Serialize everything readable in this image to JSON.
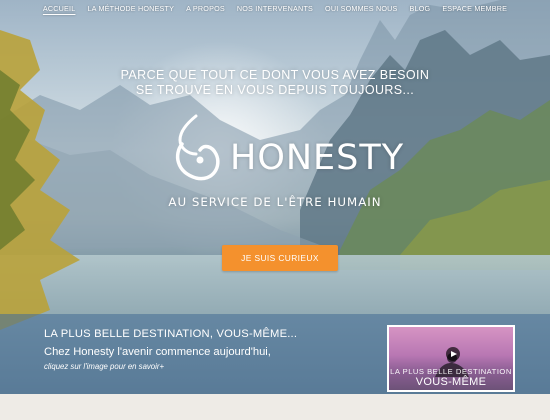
{
  "nav": {
    "items": [
      {
        "label": "ACCUEIL",
        "active": true
      },
      {
        "label": "LA MÉTHODE HONESTY",
        "active": false
      },
      {
        "label": "A PROPOS",
        "active": false
      },
      {
        "label": "NOS INTERVENANTS",
        "active": false
      },
      {
        "label": "OUI SOMMES NOUS",
        "active": false
      },
      {
        "label": "BLOG",
        "active": false
      },
      {
        "label": "ESPACE MEMBRE",
        "active": false
      }
    ]
  },
  "hero": {
    "tagline_line1": "PARCE QUE TOUT CE DONT VOUS AVEZ BESOIN",
    "tagline_line2": "SE TROUVE EN VOUS DEPUIS TOUJOURS...",
    "logo_text": "HONESTY",
    "logo_icon": "honesty-swirl-icon",
    "subtitle": "AU SERVICE DE L'ÊTRE HUMAIN",
    "cta_label": "JE SUIS CURIEUX"
  },
  "band": {
    "title": "LA PLUS BELLE DESTINATION, VOUS-MÊME...",
    "text": "Chez Honesty l'avenir commence aujourd'hui,",
    "link": "cliquez sur l'image pour en savoir+"
  },
  "video": {
    "caption_small": "LA PLUS BELLE DESTINATION",
    "caption_big": "VOUS-MÊME",
    "icon": "play-icon"
  },
  "colors": {
    "accent": "#f4912d",
    "band": "#466e96",
    "text": "#ffffff"
  }
}
